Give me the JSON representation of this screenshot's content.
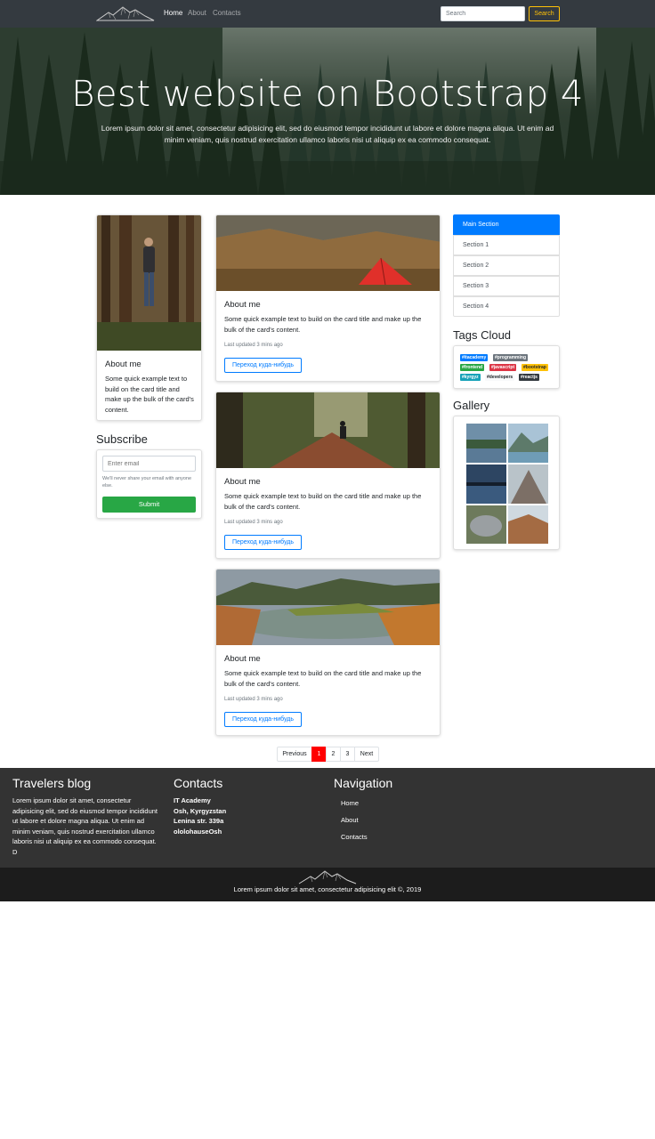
{
  "navbar": {
    "logo": "mountains-logo",
    "links": [
      "Home",
      "About",
      "Contacts"
    ],
    "search_placeholder": "Search",
    "search_button": "Search"
  },
  "hero": {
    "title": "Best website on Bootstrap 4",
    "text": "Lorem ipsum dolor sit amet, consectetur adipisicing elit, sed do eiusmod tempor incididunt ut labore et dolore magna aliqua. Ut enim ad minim veniam, quis nostrud exercitation ullamco laboris nisi ut aliquip ex ea commodo consequat."
  },
  "profile_card": {
    "image": "man-in-forest-photo",
    "title": "About me",
    "text": "Some quick example text to build on the card title and make up the bulk of the card's content."
  },
  "subscribe": {
    "heading": "Subscribe",
    "email_placeholder": "Enter email",
    "help": "We'll never share your email with anyone else.",
    "submit": "Submit"
  },
  "posts": [
    {
      "image": "tent-photo",
      "title": "About me",
      "text": "Some quick example text to build on the card title and make up the bulk of the card's content.",
      "updated": "Last updated 3 mins ago",
      "button": "Переход куда-нибудь"
    },
    {
      "image": "forest-trail-photo",
      "title": "About me",
      "text": "Some quick example text to build on the card title and make up the bulk of the card's content.",
      "updated": "Last updated 3 mins ago",
      "button": "Переход куда-нибудь"
    },
    {
      "image": "lake-photo",
      "title": "About me",
      "text": "Some quick example text to build on the card title and make up the bulk of the card's content.",
      "updated": "Last updated 3 mins ago",
      "button": "Переход куда-нибудь"
    }
  ],
  "sections": [
    "Main Section",
    "Section 1",
    "Section 2",
    "Section 3",
    "Section 4"
  ],
  "tags_heading": "Tags Cloud",
  "tags": [
    {
      "label": "#itacademy",
      "color": "#007bff"
    },
    {
      "label": "#programming",
      "color": "#6c757d"
    },
    {
      "label": "#frontend",
      "color": "#28a745"
    },
    {
      "label": "#javascript",
      "color": "#dc3545"
    },
    {
      "label": "#bootstrap",
      "color": "#ffc107"
    },
    {
      "label": "#kyrgyz",
      "color": "#17a2b8"
    },
    {
      "label": "#developers",
      "color": "#f8f9fa"
    },
    {
      "label": "#reactjs",
      "color": "#343a40"
    }
  ],
  "gallery_heading": "Gallery",
  "gallery": [
    "lake-reflection-photo",
    "mountain-lake-photo",
    "dusk-lake-photo",
    "rocky-peak-photo",
    "boulder-photo",
    "canyon-photo"
  ],
  "pagination": {
    "previous": "Previous",
    "pages": [
      "1",
      "2",
      "3"
    ],
    "next": "Next",
    "active": "1"
  },
  "footer": {
    "blog_heading": "Travelers blog",
    "blog_text": "Lorem ipsum dolor sit amet, consectetur adipisicing elit, sed do eiusmod tempor incididunt ut labore et dolore magna aliqua. Ut enim ad minim veniam, quis nostrud exercitation ullamco laboris nisi ut aliquip ex ea commodo consequat. D",
    "contacts_heading": "Contacts",
    "contacts": [
      "IT Academy",
      "Osh, Kyrgyzstan",
      "Lenina str. 339a",
      "ololohauseOsh"
    ],
    "nav_heading": "Navigation",
    "nav_links": [
      "Home",
      "About",
      "Contacts"
    ],
    "copyright": "Lorem ipsum dolor sit amet, consectetur adipisicing elit ©, 2019"
  },
  "colors": {
    "primary": "#007bff",
    "warning": "#ffc107",
    "success": "#28a745",
    "active_page": "#ff0000",
    "navbar": "#343a40",
    "footer": "#333333"
  }
}
